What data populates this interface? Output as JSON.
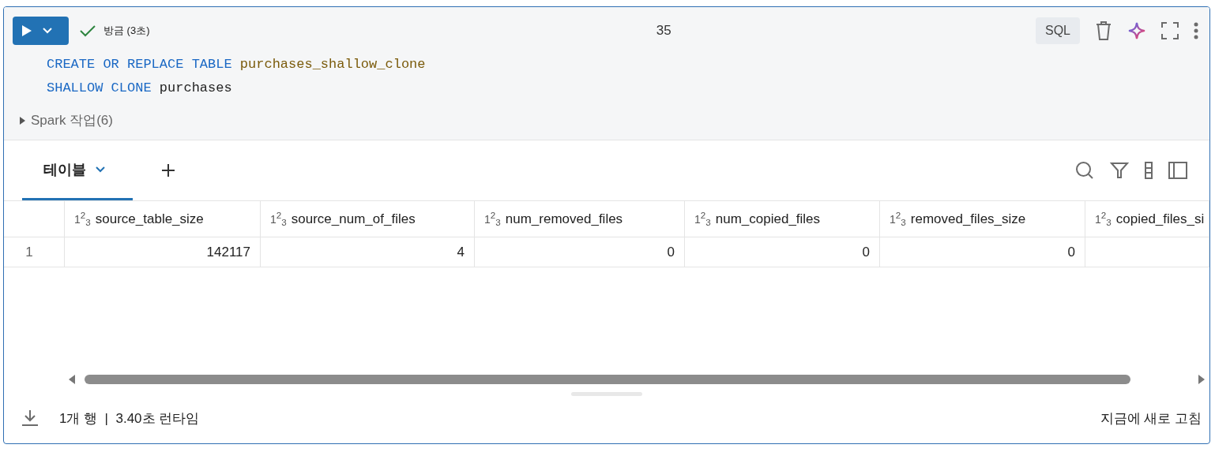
{
  "cell": {
    "status": "방금 (3초)",
    "succeeded": true,
    "cell_number": "35",
    "language": "SQL",
    "code": [
      [
        {
          "kind": "keyword",
          "text": "CREATE OR REPLACE TABLE"
        },
        {
          "kind": "ident",
          "text": "purchases_shallow_clone"
        }
      ],
      [
        {
          "kind": "keyword",
          "text": "SHALLOW CLONE"
        },
        {
          "kind": "plain",
          "text": "purchases"
        }
      ]
    ],
    "spark_jobs": {
      "label": "Spark 작업(6)",
      "expanded": false
    }
  },
  "result_tabs": [
    {
      "label": "테이블",
      "selected": true
    }
  ],
  "table": {
    "columns": [
      {
        "type_icon": "1$^{2}$$_{3}$",
        "name": "source_table_size"
      },
      {
        "type_icon": "1$^{2}$$_{3}$",
        "name": "source_num_of_files"
      },
      {
        "type_icon": "1$^{2}$$_{3}$",
        "name": "num_removed_files"
      },
      {
        "type_icon": "1$^{2}$$_{3}$",
        "name": "num_copied_files"
      },
      {
        "type_icon": "1$^{2}$$_{3}$",
        "name": "removed_files_size"
      },
      {
        "type_icon": "1$^{2}$$_{3}$",
        "name": "copied_files_si"
      }
    ],
    "rows": [
      {
        "index": "1",
        "cells": [
          "142117",
          "4",
          "0",
          "0",
          "0",
          null
        ]
      }
    ]
  },
  "footer": {
    "summary": "1개 행  |  3.40초 런타임",
    "refresh": "지금에 새로 고침"
  }
}
